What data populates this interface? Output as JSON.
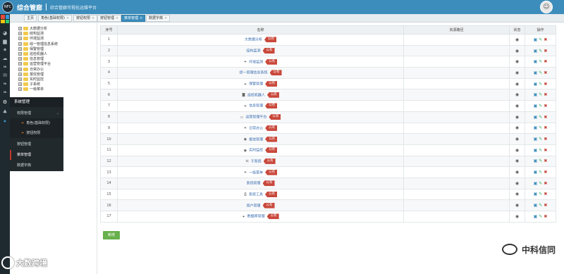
{
  "header": {
    "logo_text": "NFC",
    "brand": "综合管廊",
    "subtitle": "综合管廊可视化运维平台",
    "avatar_icon": "user-avatar-icon"
  },
  "tabs": [
    {
      "label": "主页",
      "active": false
    },
    {
      "label": "角色(基础权限)",
      "active": false
    },
    {
      "label": "按钮权限",
      "active": false
    },
    {
      "label": "按钮管理",
      "active": false
    },
    {
      "label": "菜单管理",
      "active": true
    },
    {
      "label": "数据字典",
      "active": false
    }
  ],
  "rail_icons": [
    "dashboard-icon",
    "chart-icon",
    "gear-icon",
    "cloud-icon",
    "leaf-icon",
    "mail-icon",
    "leaf-icon",
    "leaf-icon",
    "settings-icon",
    "users-icon",
    "dot-icon"
  ],
  "tree": [
    "大数据分析",
    "结构监测",
    "环境监测",
    "综一管理信息系统",
    "保警管理",
    "巡检机器人",
    "信息管理",
    "运营管理平台",
    "日常办公",
    "报信管理",
    "实时监控",
    "子系统",
    "一级菜单"
  ],
  "menu": {
    "title": "系统管理",
    "items": [
      {
        "label": "权限管理",
        "type": "group"
      },
      {
        "label": "角色(基础权限)",
        "type": "sub"
      },
      {
        "label": "按钮权限",
        "type": "sub"
      },
      {
        "label": "按钮管理",
        "type": "item"
      },
      {
        "label": "菜单管理",
        "type": "active"
      },
      {
        "label": "数据字典",
        "type": "item"
      }
    ]
  },
  "table": {
    "headers": [
      "序号",
      "名称",
      "资源路径",
      "状态",
      "操作"
    ],
    "badge_label": "公有",
    "rows": [
      {
        "no": "1",
        "name": "大数据分析",
        "icon": ""
      },
      {
        "no": "2",
        "name": "结构监测",
        "icon": ""
      },
      {
        "no": "3",
        "name": "环境监测",
        "icon": "leaf"
      },
      {
        "no": "4",
        "name": "综一管理信息系统",
        "icon": ""
      },
      {
        "no": "5",
        "name": "保警管理",
        "icon": "leaf"
      },
      {
        "no": "6",
        "name": "巡检机器人",
        "icon": "camera"
      },
      {
        "no": "7",
        "name": "信息管理",
        "icon": "leaf"
      },
      {
        "no": "8",
        "name": "运营管理平台",
        "icon": "card"
      },
      {
        "no": "9",
        "name": "日常办公",
        "icon": "leaf"
      },
      {
        "no": "10",
        "name": "报信管理",
        "icon": "eye"
      },
      {
        "no": "11",
        "name": "实时监控",
        "icon": "eye"
      },
      {
        "no": "12",
        "name": "子系统",
        "icon": "arrows"
      },
      {
        "no": "13",
        "name": "一级菜单",
        "icon": "leaf"
      },
      {
        "no": "14",
        "name": "系统管理",
        "icon": ""
      },
      {
        "no": "15",
        "name": "系统工具",
        "icon": "printer"
      },
      {
        "no": "16",
        "name": "用户管理",
        "icon": ""
      },
      {
        "no": "17",
        "name": "数据库管理",
        "icon": "leaf"
      }
    ]
  },
  "add_button": "新增",
  "watermark_left": "大数跨境",
  "watermark_right": "中科信同",
  "colors": {
    "header": "#3c8dbc",
    "badge": "#c9483b",
    "add_button": "#68b04b",
    "menu_bg": "#22292d"
  }
}
